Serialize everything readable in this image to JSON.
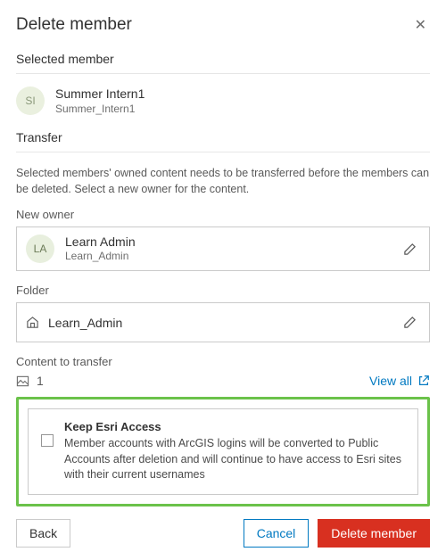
{
  "dialog": {
    "title": "Delete member",
    "close_glyph": "✕"
  },
  "selected": {
    "label": "Selected member",
    "avatar_initials": "SI",
    "name": "Summer Intern1",
    "username": "Summer_Intern1"
  },
  "transfer": {
    "label": "Transfer",
    "description": "Selected members' owned content needs to be transferred before the members can be deleted. Select a new owner for the content.",
    "new_owner_label": "New owner",
    "owner": {
      "avatar_initials": "LA",
      "name": "Learn Admin",
      "username": "Learn_Admin"
    },
    "folder_label": "Folder",
    "folder_value": "Learn_Admin"
  },
  "content": {
    "label": "Content to transfer",
    "count": "1",
    "view_all": "View all"
  },
  "keep": {
    "title": "Keep Esri Access",
    "description": "Member accounts with ArcGIS logins will be converted to Public Accounts after deletion and will continue to have access to Esri sites with their current usernames"
  },
  "footer": {
    "back": "Back",
    "cancel": "Cancel",
    "delete": "Delete member"
  }
}
